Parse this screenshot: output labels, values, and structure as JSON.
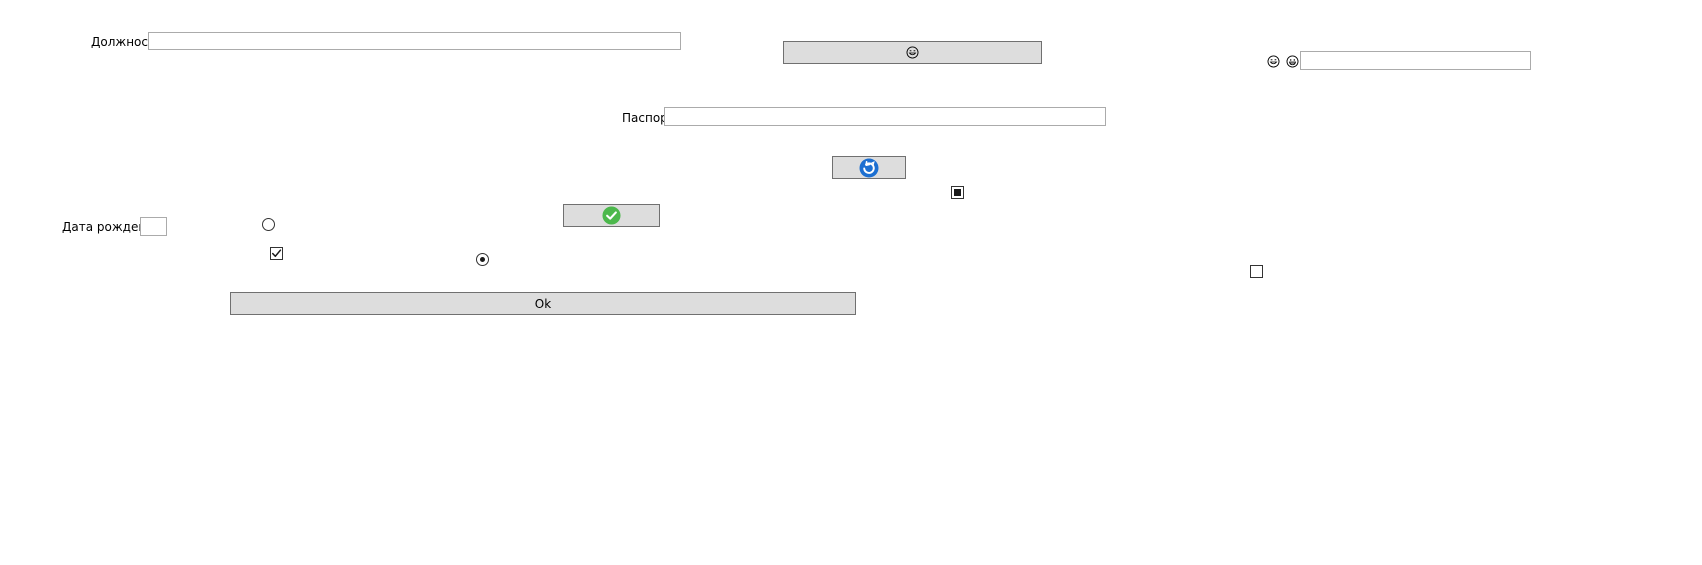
{
  "form": {
    "position_label": "Должность",
    "position_value": "",
    "passport_label": "Паспорт",
    "passport_value": "",
    "birthdate_label": "Дата рождения",
    "birthdate_value": "",
    "right_field_value": "",
    "ok_label": "Ok"
  },
  "controls": {
    "radio_top": {
      "checked": false
    },
    "radio_bottom": {
      "checked": true
    },
    "checkbox_left": {
      "state": "checked"
    },
    "checkbox_middle": {
      "state": "indeterminate"
    },
    "checkbox_right": {
      "state": "unchecked"
    }
  },
  "icons": {
    "top_button_icon": "smiley-face-icon",
    "right_icon_1": "smiley-face-icon",
    "right_icon_2": "grinning-face-icon",
    "refresh_button_icon": "refresh-icon",
    "confirm_button_icon": "checkmark-icon"
  },
  "colors": {
    "button_bg": "#dddddd",
    "button_border": "#707070",
    "field_border": "#ababab",
    "refresh_blue": "#1c6fd1",
    "confirm_green": "#4cb84c"
  }
}
